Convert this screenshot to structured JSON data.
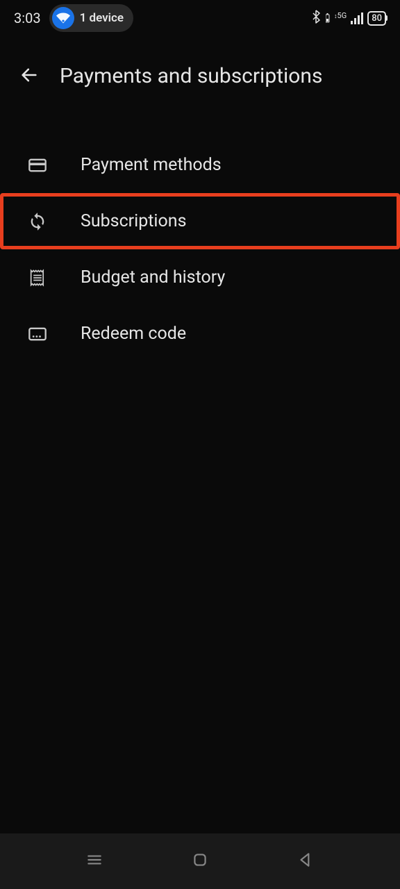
{
  "statusBar": {
    "time": "3:03",
    "deviceCount": "1 device",
    "networkType": "5G",
    "batteryLevel": "80"
  },
  "header": {
    "title": "Payments and subscriptions"
  },
  "menu": {
    "items": [
      {
        "label": "Payment methods"
      },
      {
        "label": "Subscriptions"
      },
      {
        "label": "Budget and history"
      },
      {
        "label": "Redeem code"
      }
    ]
  }
}
